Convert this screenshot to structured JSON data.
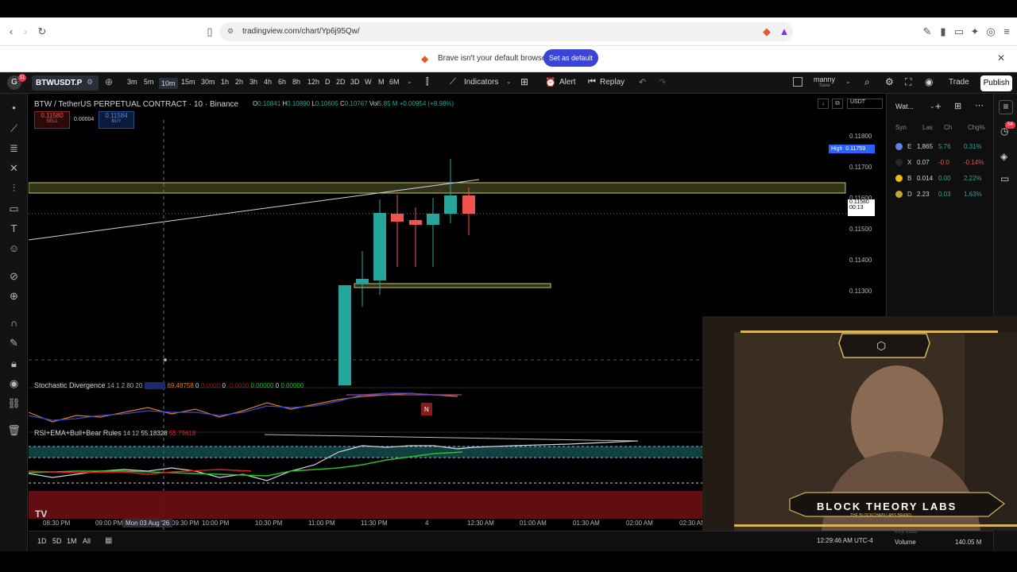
{
  "browser": {
    "url": "tradingview.com/chart/Yp6j95Qw/",
    "notice_text": "Brave isn't your default browser",
    "set_default_label": "Set as default",
    "profile_badge": "11"
  },
  "header": {
    "symbol": "BTWUSDT.P",
    "timeframes": [
      "3m",
      "5m",
      "10m",
      "15m",
      "30m",
      "1h",
      "2h",
      "3h",
      "4h",
      "6h",
      "8h",
      "12h",
      "D",
      "2D",
      "3D",
      "W",
      "M",
      "6M"
    ],
    "active_timeframe": "10m",
    "indicators_label": "Indicators",
    "alert_label": "Alert",
    "replay_label": "Replay",
    "user_name": "manny",
    "user_sub": "Save",
    "trade_label": "Trade",
    "publish_label": "Publish"
  },
  "legend": {
    "title": "BTW / TetherUS PERPETUAL CONTRACT · 10 · Binance",
    "o_label": "O",
    "o": "0.10841",
    "h_label": "H",
    "h": "0.10890",
    "l_label": "L",
    "l": "0.10605",
    "c_label": "C",
    "c": "0.10767",
    "vol_label": "Vol",
    "vol": "5.85 M",
    "change": "+0.00954 (+8.98%)",
    "sell_price": "0.11580",
    "sell_label": "SELL",
    "spread": "0.00004",
    "buy_price": "0.11584",
    "buy_label": "BUY",
    "currency": "USDT"
  },
  "price_scale": {
    "labels": [
      "0.11800",
      "0.11700",
      "0.11600",
      "0.11500",
      "0.11400",
      "0.11300"
    ],
    "high_label": "High",
    "high_value": "0.11759",
    "current": "0.11580",
    "countdown": "00:13"
  },
  "indicators": {
    "stoch_name": "Stochastic Divergence",
    "stoch_params": "14 1 2 80 20",
    "stoch_value": "69.48758",
    "stoch_zero1": "0",
    "stoch_zero2": "0",
    "stoch_value2": "0.00000",
    "stoch_zero3": "0",
    "stoch_value3": "0.00000",
    "stoch_marker": "N",
    "rsi_name": "RSI+EMA+Bull+Bear Rules",
    "rsi_params": "14 12",
    "rsi_value": "55.18328",
    "rsi_value2": "55.79618"
  },
  "time_axis": {
    "labels": [
      "08:30 PM",
      "09:00 PM",
      "09:30 PM",
      "10:00 PM",
      "10:30 PM",
      "11:00 PM",
      "11:30 PM",
      "4",
      "12:30 AM",
      "01:00 AM",
      "01:30 AM",
      "02:00 AM",
      "02:30 AM"
    ],
    "crosshair_label": "Mon 03 Aug '26"
  },
  "bottom_bar": {
    "ranges": [
      "1D",
      "5D",
      "1M",
      "All"
    ],
    "clock": "12:29:46 AM UTC-4",
    "volume_label": "Volume",
    "volume_value": "140.05 M",
    "key_stats_label": "Key stats"
  },
  "watchlist": {
    "title": "Wat...",
    "columns": [
      "Syn",
      "Las",
      "Ch",
      "Chg%"
    ],
    "rows": [
      {
        "sym": "E",
        "last": "1,865",
        "ch": "5.76",
        "chg": "0.31%",
        "color": "#26a69a"
      },
      {
        "sym": "X",
        "last": "0.07",
        "ch": "-0.0",
        "chg": "-0.14%",
        "color": "#ef5350"
      },
      {
        "sym": "B",
        "last": "0.014",
        "ch": "0.00",
        "chg": "2.22%",
        "color": "#26a69a"
      },
      {
        "sym": "D",
        "last": "2.23",
        "ch": "0.03",
        "chg": "1.63%",
        "color": "#26a69a"
      }
    ],
    "notif_count": "54"
  },
  "webcam": {
    "brand": "BLOCK THEORY LABS",
    "tagline": "THE BLOCKCHAIN LABS BRAND"
  },
  "colors": {
    "up": "#26a69a",
    "down": "#ef5350",
    "zone": "#c9c96a"
  }
}
